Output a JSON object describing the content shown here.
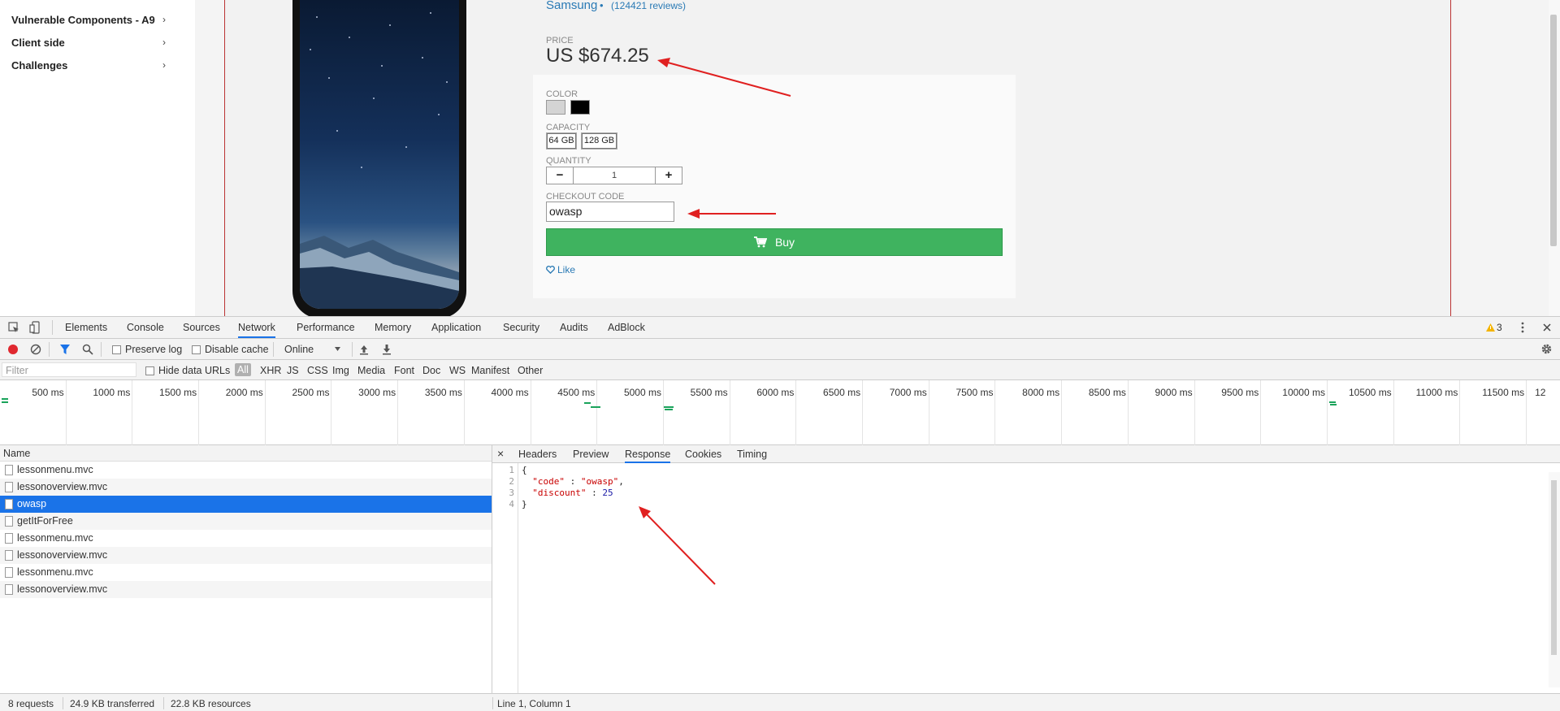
{
  "sidebar": {
    "items": [
      {
        "label": "Vulnerable Components - A9"
      },
      {
        "label": "Client side"
      },
      {
        "label": "Challenges"
      }
    ],
    "chevron": "›"
  },
  "product": {
    "brand": "Samsung",
    "dot": "•",
    "reviews": "(124421 reviews)",
    "price_label": "PRICE",
    "price": "US $674.25",
    "color_label": "COLOR",
    "colors": [
      "#d4d4d4",
      "#000000"
    ],
    "capacity_label": "CAPACITY",
    "capacities": [
      "64 GB",
      "128 GB"
    ],
    "quantity_label": "QUANTITY",
    "quantity": "1",
    "minus": "−",
    "plus": "+",
    "checkout_label": "CHECKOUT CODE",
    "checkout_code": "owasp",
    "buy_label": "Buy",
    "like_label": "Like"
  },
  "devtools": {
    "tabs": [
      "Elements",
      "Console",
      "Sources",
      "Network",
      "Performance",
      "Memory",
      "Application",
      "Security",
      "Audits",
      "AdBlock"
    ],
    "active_tab": "Network",
    "warning_count": "3",
    "preserve_log": "Preserve log",
    "disable_cache": "Disable cache",
    "throttle": "Online",
    "filter_placeholder": "Filter",
    "hide_data_urls": "Hide data URLs",
    "types": [
      "All",
      "XHR",
      "JS",
      "CSS",
      "Img",
      "Media",
      "Font",
      "Doc",
      "WS",
      "Manifest",
      "Other"
    ],
    "timeline_ticks": [
      "500 ms",
      "1000 ms",
      "1500 ms",
      "2000 ms",
      "2500 ms",
      "3000 ms",
      "3500 ms",
      "4000 ms",
      "4500 ms",
      "5000 ms",
      "5500 ms",
      "6000 ms",
      "6500 ms",
      "7000 ms",
      "7500 ms",
      "8000 ms",
      "8500 ms",
      "9000 ms",
      "9500 ms",
      "10000 ms",
      "10500 ms",
      "11000 ms",
      "11500 ms",
      "12"
    ],
    "name_header": "Name",
    "requests": [
      "lessonmenu.mvc",
      "lessonoverview.mvc",
      "owasp",
      "getItForFree",
      "lessonmenu.mvc",
      "lessonoverview.mvc",
      "lessonmenu.mvc",
      "lessonoverview.mvc"
    ],
    "selected_request": "owasp",
    "detail_tabs": [
      "Headers",
      "Preview",
      "Response",
      "Cookies",
      "Timing"
    ],
    "active_detail_tab": "Response",
    "close": "×",
    "response_lines": [
      "1",
      "2",
      "3",
      "4"
    ],
    "response": {
      "open": "{",
      "code_key": "\"code\"",
      "code_val": "\"owasp\"",
      "discount_key": "\"discount\"",
      "discount_val": "25",
      "close": "}"
    },
    "status": {
      "requests": "8 requests",
      "transferred": "24.9 KB transferred",
      "resources": "22.8 KB resources",
      "cursor": "Line 1, Column 1"
    }
  }
}
